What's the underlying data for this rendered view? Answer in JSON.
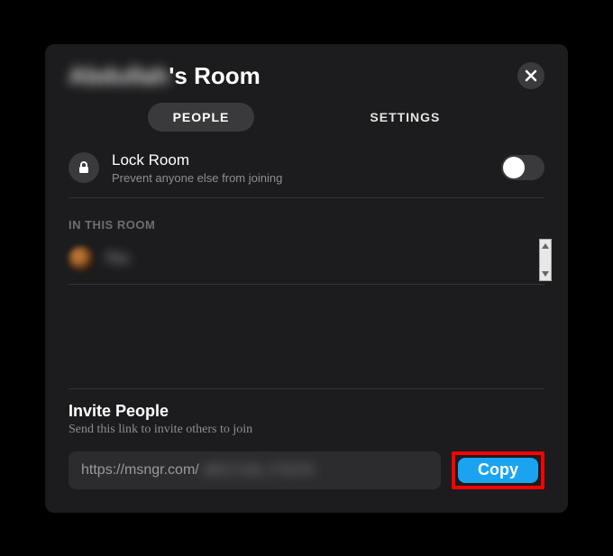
{
  "header": {
    "title_owner_blurred": "Abdullah",
    "title_suffix": "'s Room"
  },
  "tabs": {
    "people": "PEOPLE",
    "settings": "SETTINGS",
    "active": "people"
  },
  "lock": {
    "title": "Lock Room",
    "subtitle": "Prevent anyone else from joining",
    "on": false
  },
  "room": {
    "header": "IN THIS ROOM",
    "participants": [
      {
        "name_blurred": "You"
      }
    ]
  },
  "invite": {
    "title": "Invite People",
    "subtitle": "Send this link to invite others to join",
    "link_visible_prefix": "https://msngr.com/",
    "link_blurred_suffix": "aB1C2de_F3G4h",
    "copy_label": "Copy"
  },
  "annotations": {
    "copy_button_highlighted": true,
    "highlight_color": "#ff0000"
  }
}
